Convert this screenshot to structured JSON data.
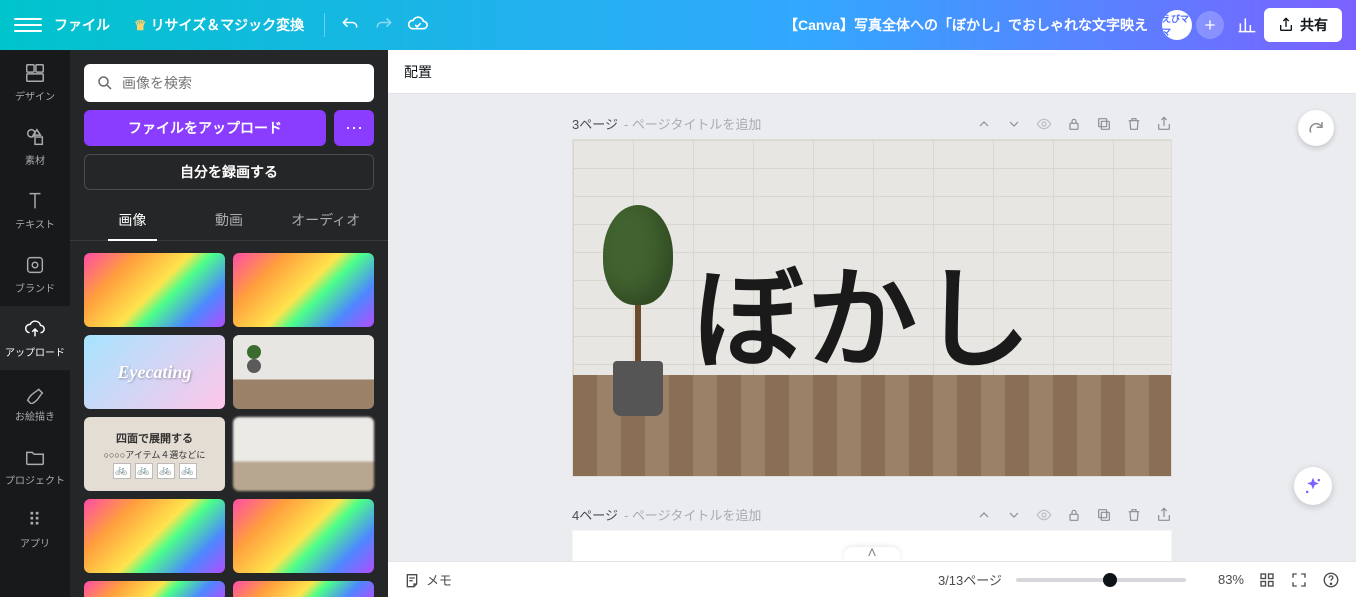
{
  "topbar": {
    "file_label": "ファイル",
    "resize_label": "リサイズ＆マジック変換",
    "doc_title": "【Canva】写真全体への「ぼかし」でおしゃれな文字映え",
    "share_label": "共有",
    "avatar_text": "えびママ"
  },
  "rail": {
    "design": "デザイン",
    "elements": "素材",
    "text": "テキスト",
    "brand": "ブランド",
    "upload": "アップロード",
    "draw": "お絵描き",
    "projects": "プロジェクト",
    "apps": "アプリ"
  },
  "sidepanel": {
    "search_placeholder": "画像を検索",
    "upload_btn": "ファイルをアップロード",
    "record_btn": "自分を録画する",
    "tabs": {
      "images": "画像",
      "video": "動画",
      "audio": "オーディオ"
    },
    "thumb_eyecatch_text": "Eyecating",
    "thumb_boxed_title": "四面で展開する",
    "thumb_boxed_sub": "○○○○アイテム４選などに"
  },
  "context_bar": {
    "position_label": "配置"
  },
  "pages": {
    "p3_num": "3ページ",
    "p4_num": "4ページ",
    "title_hint": " - ページタイトルを追加",
    "canvas_text": "ぼかし"
  },
  "bottom": {
    "notes_label": "メモ",
    "page_counter": "3/13ページ",
    "zoom_value": "83%",
    "zoom_knob_percent": 55
  }
}
